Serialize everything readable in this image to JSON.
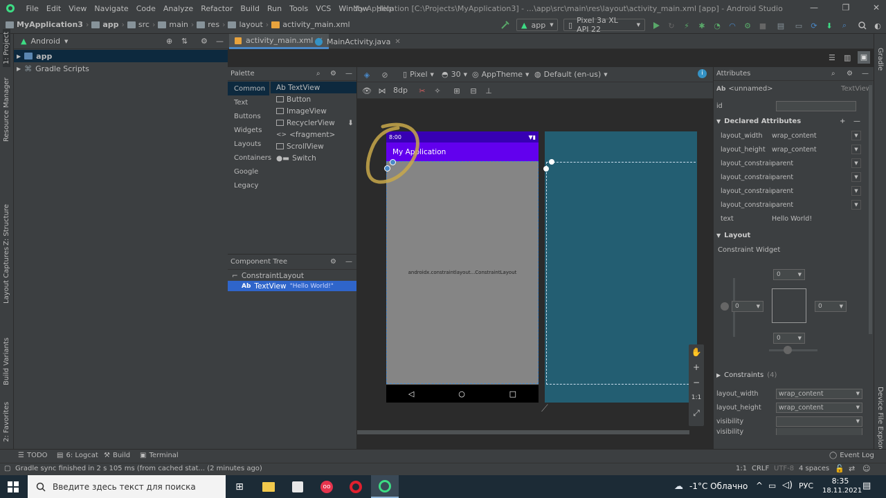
{
  "menubar": {
    "items": [
      "File",
      "Edit",
      "View",
      "Navigate",
      "Code",
      "Analyze",
      "Refactor",
      "Build",
      "Run",
      "Tools",
      "VCS",
      "Window",
      "Help"
    ],
    "window_title": "My Application [C:\\Projects\\MyApplication3] - ...\\app\\src\\main\\res\\layout\\activity_main.xml [app] - Android Studio"
  },
  "navbar": {
    "breadcrumbs": [
      "MyApplication3",
      "app",
      "src",
      "main",
      "res",
      "layout",
      "activity_main.xml"
    ],
    "run_config": "app",
    "device": "Pixel 3a XL API 22"
  },
  "left_stripe": {
    "labels": [
      "1: Project",
      "Resource Manager",
      "Z: Structure",
      "Layout Captures",
      "Build Variants",
      "2: Favorites"
    ]
  },
  "right_stripe": {
    "labels": [
      "Gradle",
      "Device File Explorer"
    ]
  },
  "project": {
    "view_mode": "Android",
    "items": [
      {
        "label": "app",
        "selected": true
      },
      {
        "label": "Gradle Scripts",
        "selected": false
      }
    ]
  },
  "tabs": [
    {
      "label": "activity_main.xml",
      "active": true
    },
    {
      "label": "MainActivity.java",
      "active": false
    }
  ],
  "design_toolbar": {
    "device": "Pixel",
    "api": "30",
    "theme": "AppTheme",
    "locale": "Default (en-us)"
  },
  "canvas_toolbar": {
    "margin": "8dp"
  },
  "palette": {
    "title": "Palette",
    "categories": [
      "Common",
      "Text",
      "Buttons",
      "Widgets",
      "Layouts",
      "Containers",
      "Google",
      "Legacy"
    ],
    "widgets": [
      "Ab TextView",
      "Button",
      "ImageView",
      "RecyclerView",
      "<fragment>",
      "ScrollView",
      "Switch"
    ]
  },
  "component_tree": {
    "title": "Component Tree",
    "root": "ConstraintLayout",
    "child_prefix": "Ab",
    "child": "TextView",
    "child_text": "\"Hello World!\""
  },
  "phone": {
    "time": "8:00",
    "app_title": "My Application",
    "layout_label": "androidx.constraintlayout...ConstraintLayout"
  },
  "zoom_controls": [
    "✋",
    "+",
    "−",
    "1:1",
    "⤢"
  ],
  "attributes": {
    "title": "Attributes",
    "widget_prefix": "Ab",
    "widget_name": "<unnamed>",
    "widget_type": "TextView",
    "id_label": "id",
    "declared_title": "Declared Attributes",
    "declared": [
      {
        "key": "layout_width",
        "value": "wrap_content"
      },
      {
        "key": "layout_height",
        "value": "wrap_content"
      },
      {
        "key": "layout_constraint...",
        "value": "parent"
      },
      {
        "key": "layout_constraint...",
        "value": "parent"
      },
      {
        "key": "layout_constraint...",
        "value": "parent"
      },
      {
        "key": "layout_constraint...",
        "value": "parent"
      },
      {
        "key": "text",
        "value": "Hello World!"
      }
    ],
    "layout_title": "Layout",
    "constraint_widget_label": "Constraint Widget",
    "margins": {
      "top": "0",
      "left": "0",
      "right": "0",
      "bottom": "0"
    },
    "constraints_label": "Constraints",
    "constraints_count": "(4)",
    "bottom_rows": [
      {
        "key": "layout_width",
        "value": "wrap_content"
      },
      {
        "key": "layout_height",
        "value": "wrap_content"
      },
      {
        "key": "visibility",
        "value": ""
      },
      {
        "key": "visibility",
        "value": ""
      }
    ]
  },
  "bottom_tools": [
    {
      "label": "TODO"
    },
    {
      "label": "6: Logcat"
    },
    {
      "label": "Build"
    },
    {
      "label": "Terminal"
    }
  ],
  "event_log": "Event Log",
  "statusbar": {
    "message": "Gradle sync finished in 2 s 105 ms (from cached stat... (2 minutes ago)",
    "position": "1:1",
    "line_sep": "CRLF",
    "encoding": "UTF-8",
    "indent": "4 spaces"
  },
  "taskbar": {
    "search_placeholder": "Введите здесь текст для поиска",
    "weather": "-1°C Облачно",
    "language": "РУС",
    "time": "8:35",
    "date": "18.11.2021"
  },
  "colors": {
    "accent": "#4a88c7",
    "status_bar": "#3700b3",
    "app_bar": "#6200ee",
    "blueprint": "#235e72",
    "annotation": "#c8a84a"
  }
}
